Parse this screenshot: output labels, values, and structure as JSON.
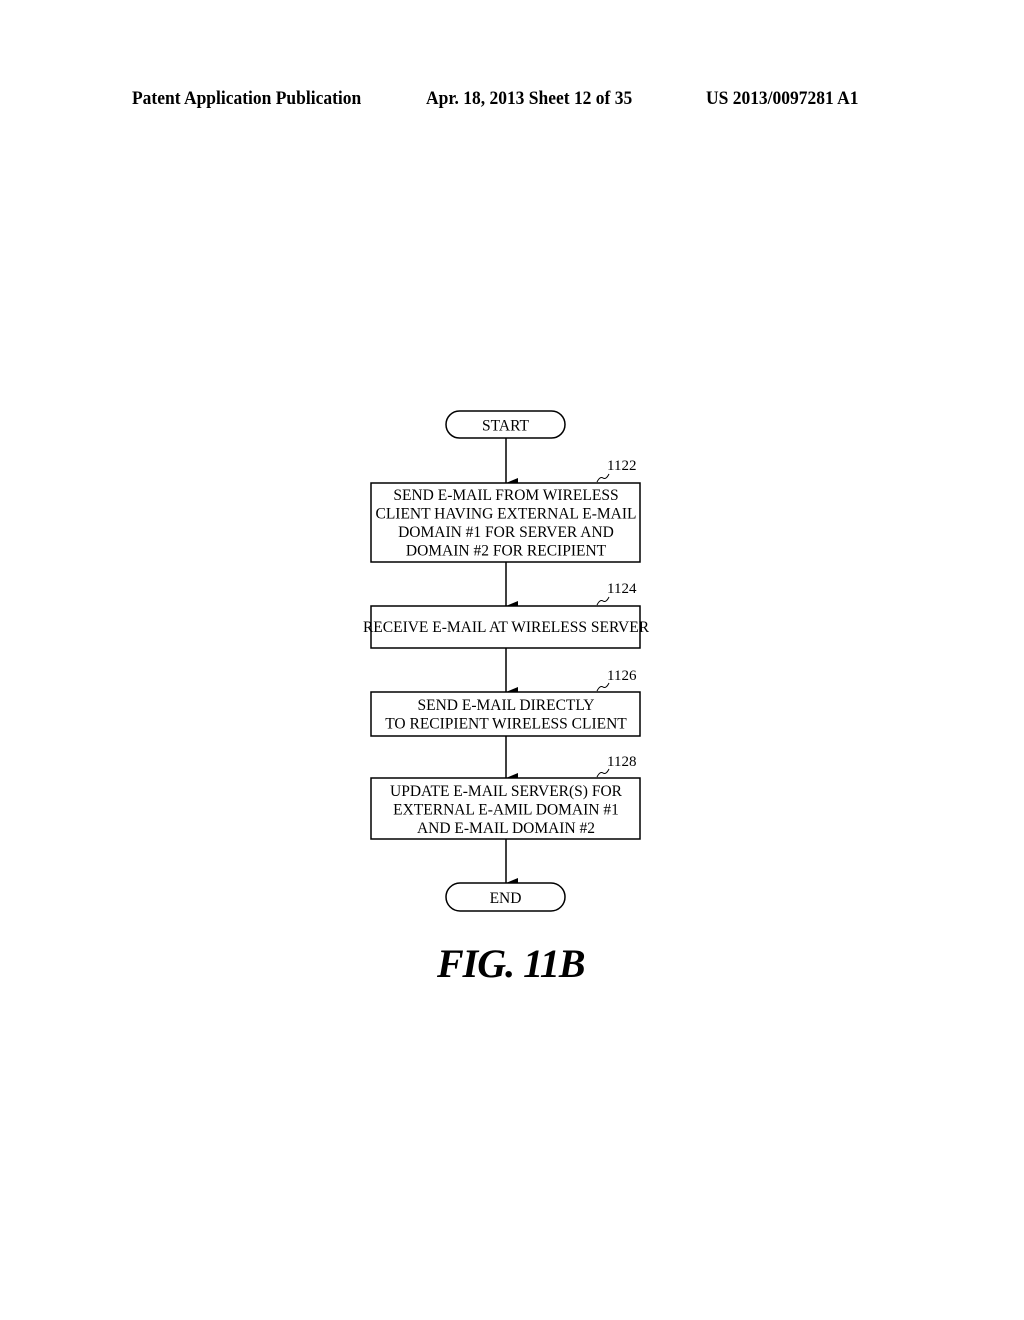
{
  "header": {
    "publication": "Patent Application Publication",
    "date_sheet": "Apr. 18, 2013  Sheet 12 of 35",
    "number": "US 2013/0097281 A1"
  },
  "flowchart": {
    "start_label": "START",
    "end_label": "END",
    "steps": [
      {
        "ref": "1122",
        "lines": [
          "SEND E-MAIL FROM WIRELESS",
          "CLIENT HAVING EXTERNAL E-MAIL",
          "DOMAIN #1 FOR SERVER AND",
          "DOMAIN #2 FOR RECIPIENT"
        ]
      },
      {
        "ref": "1124",
        "lines": [
          "RECEIVE E-MAIL AT WIRELESS SERVER"
        ]
      },
      {
        "ref": "1126",
        "lines": [
          "SEND E-MAIL DIRECTLY",
          "TO RECIPIENT WIRELESS CLIENT"
        ]
      },
      {
        "ref": "1128",
        "lines": [
          "UPDATE E-MAIL SERVER(S) FOR",
          "EXTERNAL E-AMIL DOMAIN #1",
          "AND E-MAIL DOMAIN #2"
        ]
      }
    ]
  },
  "figure_label": "FIG. 11B"
}
